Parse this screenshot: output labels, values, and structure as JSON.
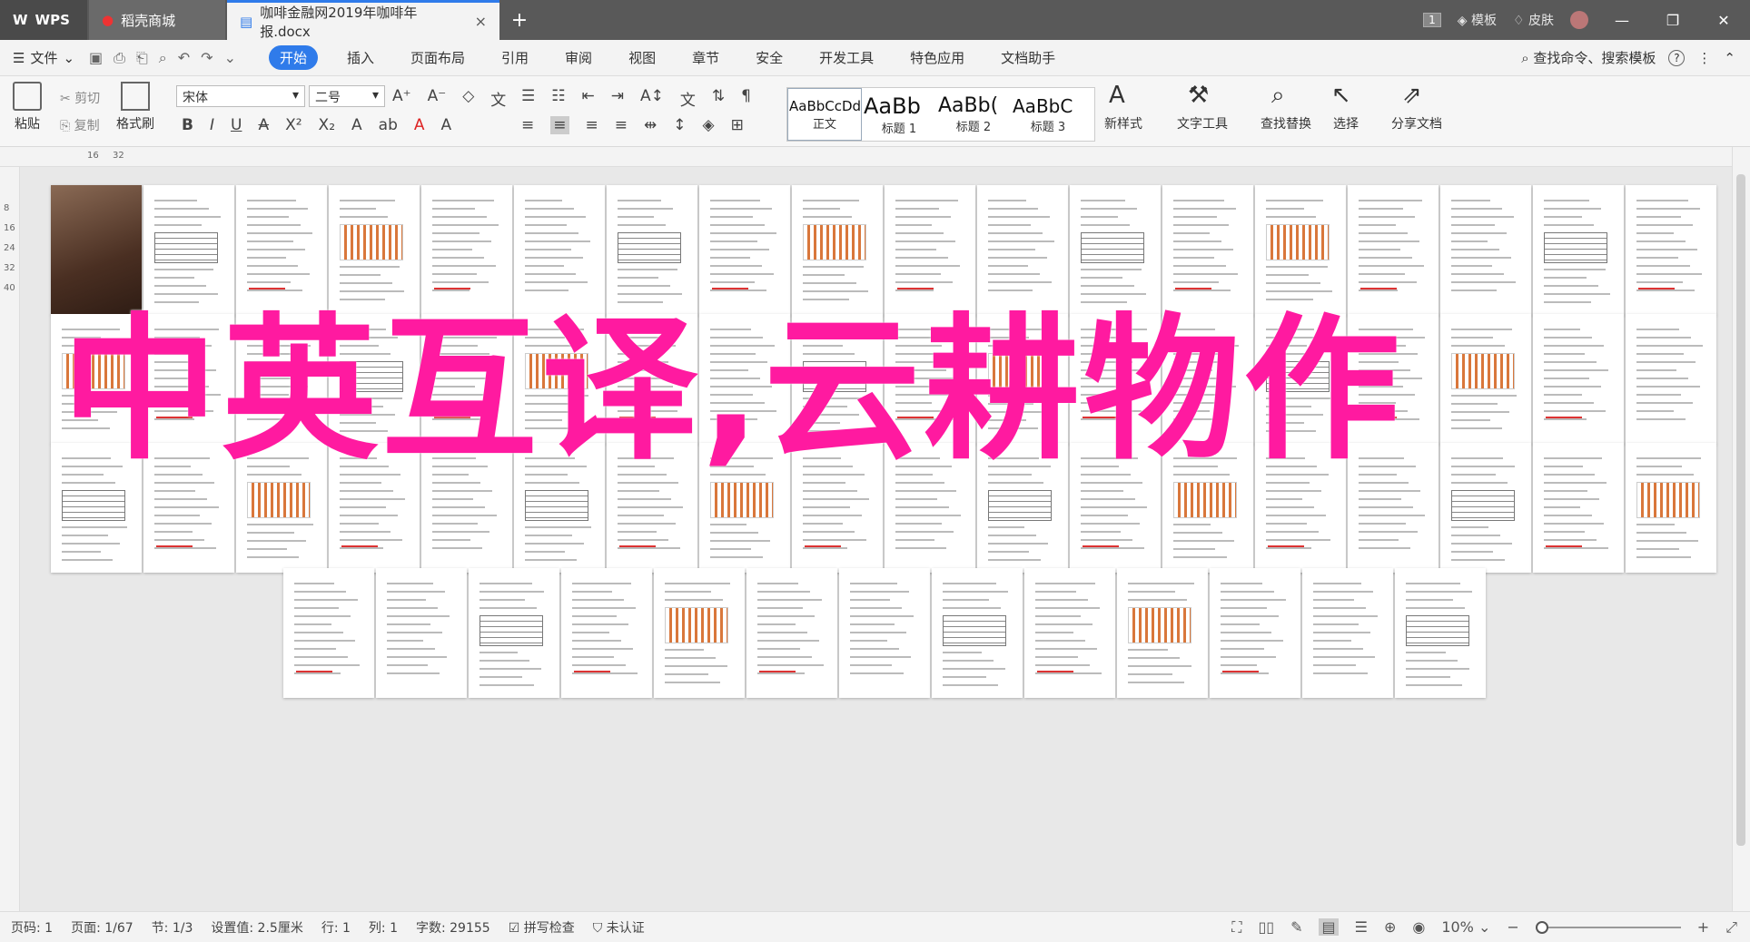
{
  "titlebar": {
    "wps_label": "WPS",
    "store_label": "稻壳商城",
    "doc_tab": "咖啡金融网2019年咖啡年报.docx",
    "page_badge": "1",
    "template_label": "模板",
    "skin_label": "皮肤",
    "add_tab": "+",
    "close": "×"
  },
  "menubar": {
    "file_label": "文件",
    "items": [
      "开始",
      "插入",
      "页面布局",
      "引用",
      "审阅",
      "视图",
      "章节",
      "安全",
      "开发工具",
      "特色应用",
      "文档助手"
    ],
    "active_item": "开始",
    "search_label": "查找命令、搜索模板",
    "help": "?"
  },
  "ribbon": {
    "paste": "粘贴",
    "cut": "剪切",
    "copy": "复制",
    "format_painter": "格式刷",
    "font_name": "宋体",
    "font_size": "二号",
    "styles": [
      {
        "sample": "AaBbCcDd",
        "name": "正文"
      },
      {
        "sample": "AaBb",
        "name": "标题 1"
      },
      {
        "sample": "AaBb(",
        "name": "标题 2"
      },
      {
        "sample": "AaBbC",
        "name": "标题 3"
      }
    ],
    "new_style": "新样式",
    "text_tools": "文字工具",
    "find_replace": "查找替换",
    "select": "选择",
    "share_doc": "分享文档"
  },
  "ruler": {
    "h_marks": [
      "16",
      "32"
    ],
    "v_marks": [
      "8",
      "16",
      "24",
      "32",
      "40"
    ]
  },
  "watermark": "中英互译,云耕物作",
  "statusbar": {
    "page_no": "页码: 1",
    "page": "页面: 1/67",
    "section": "节: 1/3",
    "setting": "设置值: 2.5厘米",
    "row": "行: 1",
    "col": "列: 1",
    "word_count": "字数: 29155",
    "spell_check": "拼写检查",
    "not_certified": "未认证",
    "zoom": "10%"
  }
}
